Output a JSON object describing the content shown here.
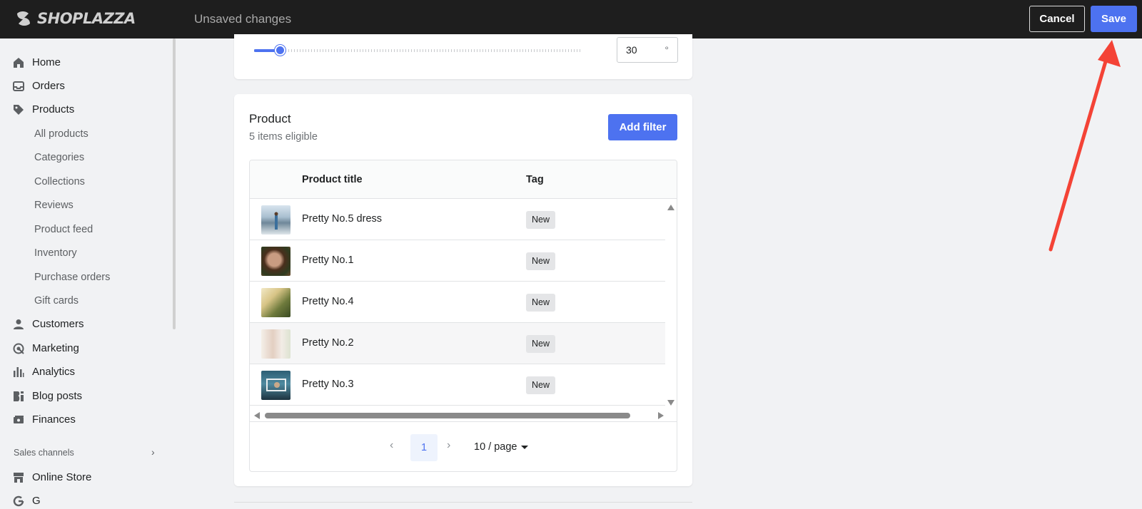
{
  "topbar": {
    "logo_text": "SHOPLAZZA",
    "status": "Unsaved changes",
    "cancel_label": "Cancel",
    "save_label": "Save"
  },
  "sidebar": {
    "items": [
      {
        "label": "Home",
        "icon": "home-icon"
      },
      {
        "label": "Orders",
        "icon": "inbox-icon"
      },
      {
        "label": "Products",
        "icon": "tag-icon"
      },
      {
        "label": "Customers",
        "icon": "person-icon"
      },
      {
        "label": "Marketing",
        "icon": "target-icon"
      },
      {
        "label": "Analytics",
        "icon": "bar-chart-icon"
      },
      {
        "label": "Blog posts",
        "icon": "blog-icon"
      },
      {
        "label": "Finances",
        "icon": "money-icon"
      },
      {
        "label": "Online Store",
        "icon": "store-icon"
      }
    ],
    "product_subitems": [
      "All products",
      "Categories",
      "Collections",
      "Reviews",
      "Product feed",
      "Inventory",
      "Purchase orders",
      "Gift cards"
    ],
    "section_title": "Sales channels",
    "cut_item": "G"
  },
  "slider": {
    "value": "30",
    "unit": "°"
  },
  "product_card": {
    "title": "Product",
    "subtitle": "5 items eligible",
    "add_filter_label": "Add filter",
    "columns": [
      "Product title",
      "Tag"
    ],
    "rows": [
      {
        "title": "Pretty No.5 dress",
        "tag": "New"
      },
      {
        "title": "Pretty No.1",
        "tag": "New"
      },
      {
        "title": "Pretty No.4",
        "tag": "New"
      },
      {
        "title": "Pretty No.2",
        "tag": "New"
      },
      {
        "title": "Pretty No.3",
        "tag": "New"
      }
    ],
    "pagination": {
      "current_page": "1",
      "page_size": "10 / page"
    }
  },
  "colors": {
    "accent": "#4d72f0",
    "topbar": "#1e1e1e",
    "annotation": "#f44336"
  }
}
